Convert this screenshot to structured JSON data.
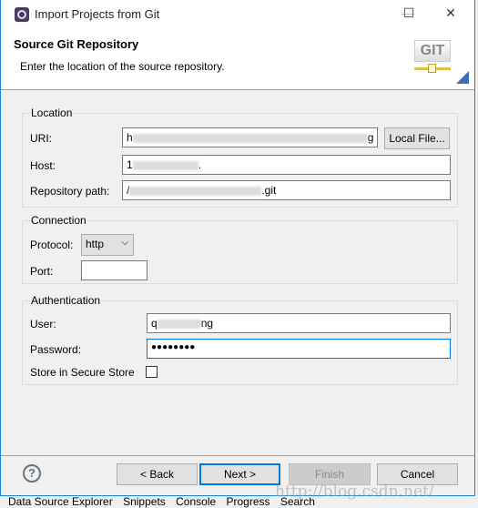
{
  "window": {
    "title": "Import Projects from Git",
    "minimize": "—",
    "maximize": "☐",
    "close": "✕"
  },
  "header": {
    "title": "Source Git Repository",
    "description": "Enter the location of the source repository.",
    "icon_text": "GIT"
  },
  "location": {
    "label": "Location",
    "uri_label": "URI:",
    "uri_start": "h",
    "uri_end": "g",
    "local_file": "Local File...",
    "host_label": "Host:",
    "host_start": "1",
    "host_end": ".",
    "path_label": "Repository path:",
    "path_start": "/",
    "path_end": ".git"
  },
  "connection": {
    "label": "Connection",
    "protocol_label": "Protocol:",
    "protocol": "http",
    "port_label": "Port:",
    "port": ""
  },
  "auth": {
    "label": "Authentication",
    "user_label": "User:",
    "user_start": "q",
    "user_end": "ng",
    "password_label": "Password:",
    "password": "●●●●●●●●",
    "store_label": "Store in Secure Store",
    "store_checked": false
  },
  "buttons": {
    "help": "?",
    "back": "< Back",
    "next": "Next >",
    "finish": "Finish",
    "cancel": "Cancel"
  },
  "taskbar": [
    "Data Source Explorer",
    "Snippets",
    "Console",
    "Progress",
    "Search"
  ],
  "watermark": "http://blog.csdn.net/"
}
